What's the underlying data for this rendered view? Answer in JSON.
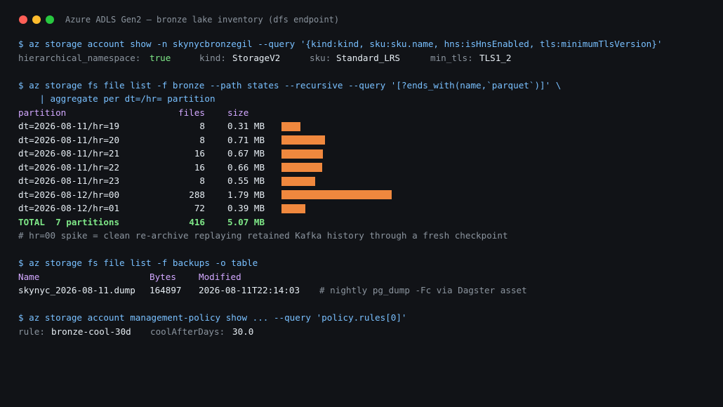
{
  "window": {
    "title": "Azure ADLS Gen2 — bronze lake inventory (dfs endpoint)",
    "colors": {
      "close": "#ff5f57",
      "minimize": "#febc2e",
      "maximize": "#28c840",
      "bar": "#f0883e",
      "command": "#79c0ff",
      "header": "#d2a8ff",
      "ok": "#7ee787"
    }
  },
  "account_show": {
    "command": "$ az storage account show -n skynycbronzegil --query '{kind:kind, sku:sku.name, hns:isHnsEnabled, tls:minimumTlsVersion}'",
    "hns_key": "hierarchical_namespace:",
    "hns_value": "true",
    "kind_key": "kind:",
    "kind_value": "StorageV2",
    "sku_key": "sku:",
    "sku_value": "Standard_LRS",
    "tls_key": "min_tls:",
    "tls_value": "TLS1_2"
  },
  "fs_list": {
    "command": "$ az storage fs file list -f bronze --path states --recursive --query '[?ends_with(name,`parquet`)]' \\",
    "command_cont": "    | aggregate per dt=/hr= partition",
    "headers": {
      "partition": "partition",
      "files": "files",
      "size": "size"
    },
    "max_mb": 1.79,
    "rows": [
      {
        "partition": "dt=2026-08-11/hr=19",
        "files": "8",
        "size": "0.31 MB",
        "mb": 0.31
      },
      {
        "partition": "dt=2026-08-11/hr=20",
        "files": "8",
        "size": "0.71 MB",
        "mb": 0.71
      },
      {
        "partition": "dt=2026-08-11/hr=21",
        "files": "16",
        "size": "0.67 MB",
        "mb": 0.67
      },
      {
        "partition": "dt=2026-08-11/hr=22",
        "files": "16",
        "size": "0.66 MB",
        "mb": 0.66
      },
      {
        "partition": "dt=2026-08-11/hr=23",
        "files": "8",
        "size": "0.55 MB",
        "mb": 0.55
      },
      {
        "partition": "dt=2026-08-12/hr=00",
        "files": "288",
        "size": "1.79 MB",
        "mb": 1.79
      },
      {
        "partition": "dt=2026-08-12/hr=01",
        "files": "72",
        "size": "0.39 MB",
        "mb": 0.39
      }
    ],
    "total": {
      "label": "TOTAL  7 partitions",
      "files": "416",
      "size": "5.07 MB"
    },
    "comment": "# hr=00 spike = clean re-archive replaying retained Kafka history through a fresh checkpoint"
  },
  "backups": {
    "command": "$ az storage fs file list -f backups -o table",
    "headers": {
      "name": "Name",
      "bytes": "Bytes",
      "modified": "Modified"
    },
    "row": {
      "name": "skynyc_2026-08-11.dump",
      "bytes": "164897",
      "modified": "2026-08-11T22:14:03"
    },
    "comment": "# nightly pg_dump -Fc via Dagster asset"
  },
  "policy": {
    "command": "$ az storage account management-policy show ... --query 'policy.rules[0]'",
    "rule_key": "rule:",
    "rule_value": "bronze-cool-30d",
    "cool_key": "coolAfterDays:",
    "cool_value": "30.0"
  }
}
